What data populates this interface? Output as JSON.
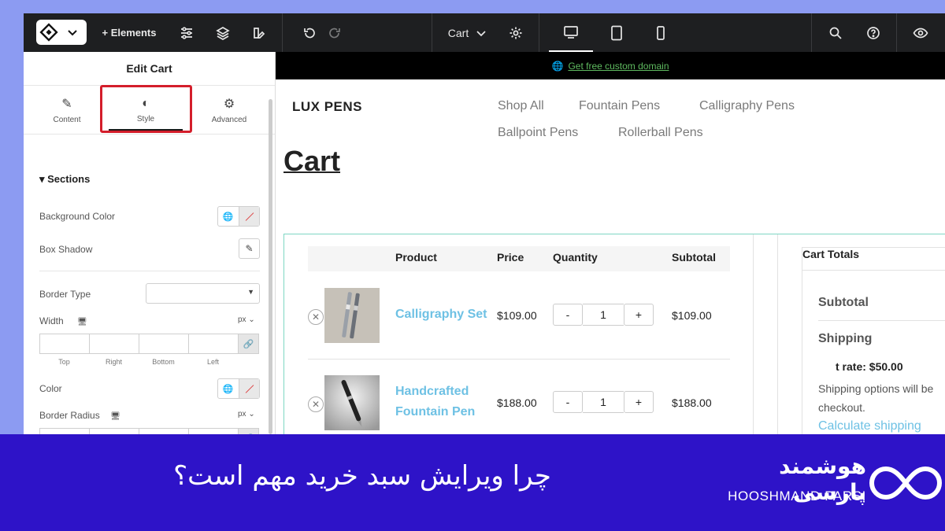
{
  "topbar": {
    "add_elements_label": "+ Elements",
    "page_name": "Cart"
  },
  "panel": {
    "title": "Edit Cart",
    "tabs": [
      {
        "label": "Content",
        "icon": "pencil-icon"
      },
      {
        "label": "Style",
        "icon": "contrast-icon",
        "active": true
      },
      {
        "label": "Advanced",
        "icon": "gear-icon"
      }
    ],
    "section_title": "Sections",
    "controls": {
      "background_color": "Background Color",
      "box_shadow": "Box Shadow",
      "border_type": "Border Type",
      "width": "Width",
      "width_unit": "px",
      "sides": [
        "Top",
        "Right",
        "Bottom",
        "Left"
      ],
      "color": "Color",
      "border_radius": "Border Radius",
      "radius_unit": "px"
    }
  },
  "site": {
    "promo_link": "Get free custom domain",
    "brand": "LUX PENS",
    "nav": [
      "Shop All",
      "Fountain Pens",
      "Calligraphy Pens",
      "Ballpoint Pens",
      "Rollerball Pens"
    ],
    "page_title": "Cart",
    "table_headers": {
      "product": "Product",
      "price": "Price",
      "quantity": "Quantity",
      "subtotal": "Subtotal"
    },
    "items": [
      {
        "name": "Calligraphy Set",
        "price": "$109.00",
        "qty": "1",
        "subtotal": "$109.00"
      },
      {
        "name_line1": "Handcrafted",
        "name_line2": "Fountain Pen",
        "price": "$188.00",
        "qty": "1",
        "subtotal": "$188.00"
      }
    ],
    "qty_minus": "-",
    "qty_plus": "+",
    "totals": {
      "title": "Cart Totals",
      "subtotal_label": "Subtotal",
      "shipping_label": "Shipping",
      "flat_rate": "t rate: $50.00",
      "shipping_note_1": "Shipping options will be",
      "shipping_note_2": "checkout.",
      "calc_link": "Calculate shipping"
    }
  },
  "banner": {
    "headline": "چرا ویرایش سبد خرید مهم است؟",
    "brand_fa": "هوشمند پارسی",
    "brand_en": "HOOSHMAND PARSI"
  },
  "colors": {
    "accent_link": "#6ec1e4",
    "highlight_box": "#d41e2b",
    "banner_bg": "#2e13c8",
    "promo_link": "#5fbb60"
  }
}
